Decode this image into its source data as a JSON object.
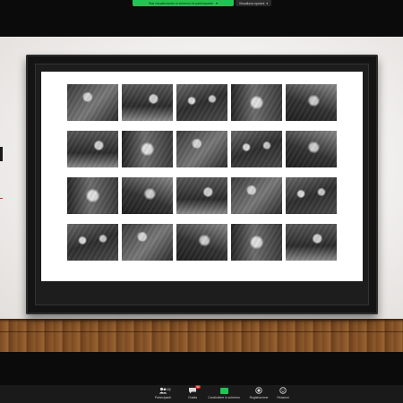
{
  "top_bar": {
    "share_status": "Stai visualizzando lo schermo di partecipante",
    "view_options": "Visualizza opzioni"
  },
  "shared_screen": {
    "gallery": {
      "rows": 4,
      "columns": 5,
      "photos": [
        "p0",
        "p1",
        "p2",
        "p3",
        "p4",
        "p1",
        "p3",
        "p0",
        "p2",
        "p4",
        "p3",
        "p4",
        "p1",
        "p0",
        "p2",
        "p2",
        "p0",
        "p4",
        "p3",
        "p1"
      ]
    }
  },
  "toolbar": {
    "participants": {
      "label": "Partecipanti",
      "count": "100",
      "icon": "participants-icon"
    },
    "chat": {
      "label": "Chatta",
      "badge": "99",
      "icon": "chat-icon"
    },
    "share": {
      "label": "Condividere lo schermo",
      "icon": "share-screen-icon",
      "color": "#23c454"
    },
    "record": {
      "label": "Registrazione",
      "icon": "record-icon"
    },
    "reactions": {
      "label": "Reazioni",
      "icon": "reactions-icon"
    }
  }
}
